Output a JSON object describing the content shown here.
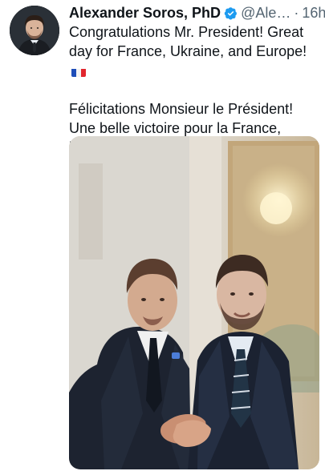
{
  "tweet": {
    "display_name": "Alexander Soros, PhD",
    "handle": "@Ale…",
    "separator": "·",
    "time": "16h",
    "text_en": "Congratulations Mr. President! Great day for France, Ukraine, and Europe!",
    "text_fr": "Félicitations Monsieur le Président! Une belle victoire pour la France, l’Ukraine, et l’Europe. Vive la France!",
    "flag_icon": "france-flag-icon",
    "verified_icon": "verified-badge-icon",
    "more_icon": "more-options-icon"
  },
  "colors": {
    "verified_blue": "#1d9bf0",
    "muted_text": "#536471",
    "text": "#0f1419"
  }
}
